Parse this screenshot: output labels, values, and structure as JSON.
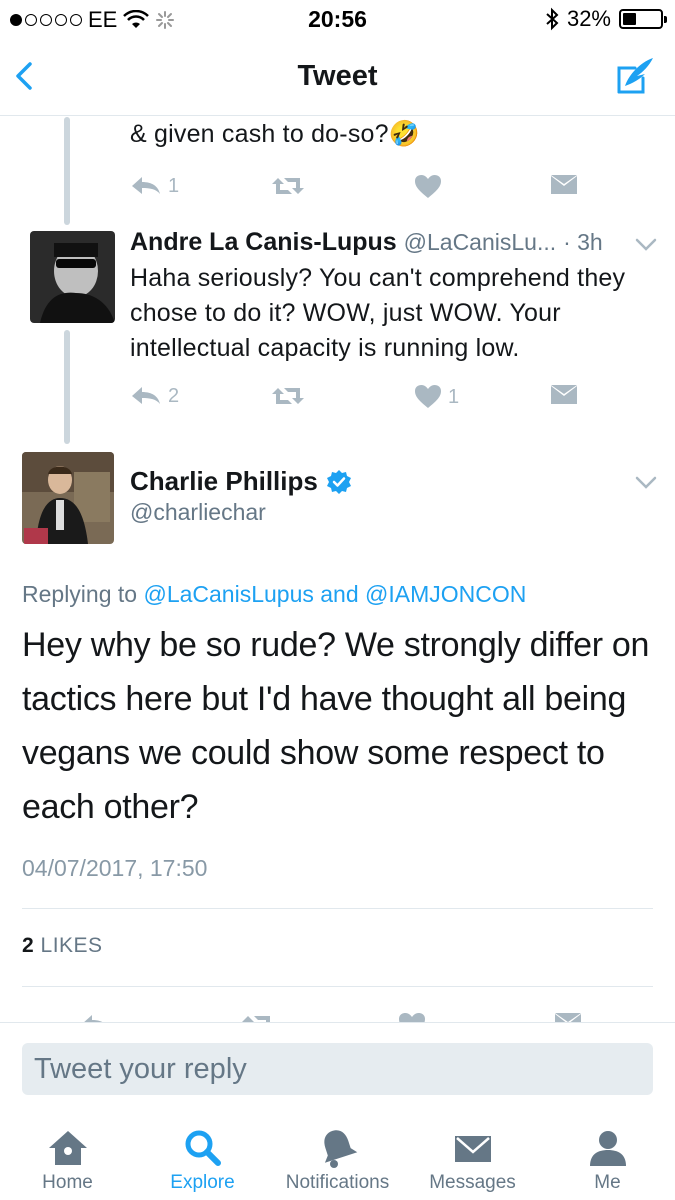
{
  "status_bar": {
    "carrier": "EE",
    "time": "20:56",
    "battery": "32%",
    "battery_level": 0.32
  },
  "nav": {
    "title": "Tweet"
  },
  "thread": {
    "prev_tweet": {
      "text_tail": "& given cash to do-so?🤣",
      "reply_count": "1",
      "retweet_count": "",
      "like_count": ""
    },
    "reply_tweet": {
      "author_name": "Andre La Canis-Lupus",
      "author_handle": "@LaCanisLu...",
      "time": "· 3h",
      "text": "Haha seriously? You can't comprehend they chose to do it? WOW, just WOW. Your intellectual capacity is running low.",
      "reply_count": "2",
      "retweet_count": "",
      "like_count": "1"
    }
  },
  "main_tweet": {
    "author_name": "Charlie Phillips",
    "author_handle": "@charliechar",
    "replying_prefix": "Replying to",
    "replying_to_1": "@LaCanisLupus",
    "replying_and": "and",
    "replying_to_2": "@IAMJONCON",
    "text": "Hey why be so rude? We strongly differ on tactics here but I'd have thought all being vegans we could show some respect to each other?",
    "timestamp": "04/07/2017, 17:50",
    "likes_count": "2",
    "likes_label": "LIKES"
  },
  "reply_box": {
    "placeholder": "Tweet your reply"
  },
  "tabs": [
    {
      "label": "Home",
      "icon": "home-icon"
    },
    {
      "label": "Explore",
      "icon": "search-icon",
      "active": true
    },
    {
      "label": "Notifications",
      "icon": "bell-icon"
    },
    {
      "label": "Messages",
      "icon": "envelope-icon"
    },
    {
      "label": "Me",
      "icon": "person-icon"
    }
  ],
  "colors": {
    "accent": "#1da1f2",
    "muted": "#657786",
    "icon_gray": "#aab8c2",
    "verified": "#1da1f2"
  }
}
